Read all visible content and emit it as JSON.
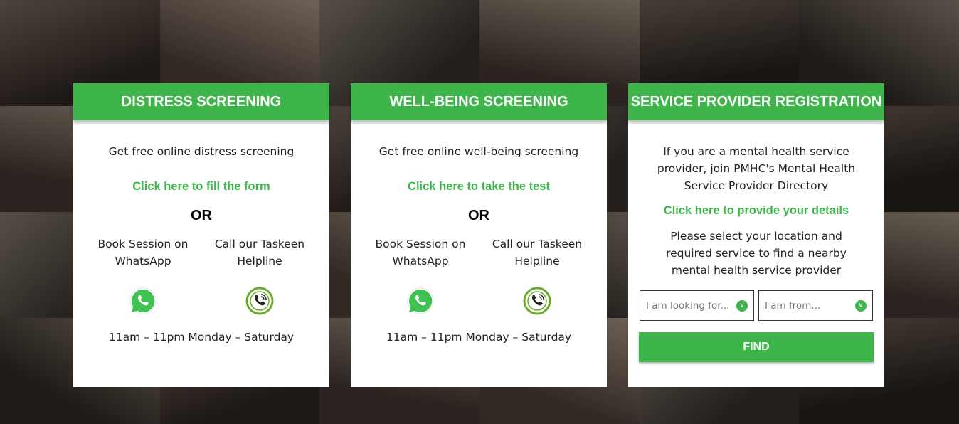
{
  "colors": {
    "accent": "#3db54a",
    "card_bg": "#ffffff"
  },
  "cards": [
    {
      "title": "DISTRESS SCREENING",
      "description": "Get free online distress screening",
      "link": "Click here to fill the form",
      "or": "OR",
      "whatsapp_label": "Book Session on WhatsApp",
      "helpline_label": "Call our Taskeen Helpline",
      "hours": "11am – 11pm Monday – Saturday",
      "icons": [
        "whatsapp-icon",
        "phone-icon"
      ]
    },
    {
      "title": "WELL-BEING SCREENING",
      "description": "Get free online well-being screening",
      "link": "Click here to take the test",
      "or": "OR",
      "whatsapp_label": "Book Session on WhatsApp",
      "helpline_label": "Call our Taskeen Helpline",
      "hours": "11am – 11pm Monday – Saturday",
      "icons": [
        "whatsapp-icon",
        "phone-icon"
      ]
    },
    {
      "title": "SERVICE PROVIDER REGISTRATION",
      "description": "If you are a mental health service provider, join PMHC's Mental Health Service Provider Directory",
      "link": "Click here to provide your details",
      "description2": "Please select your location and required service to find a nearby mental health service provider",
      "select_service": "I am looking for...",
      "select_location": "I am from...",
      "find_label": "FIND",
      "icons": [
        "chevron-down-icon"
      ]
    }
  ]
}
